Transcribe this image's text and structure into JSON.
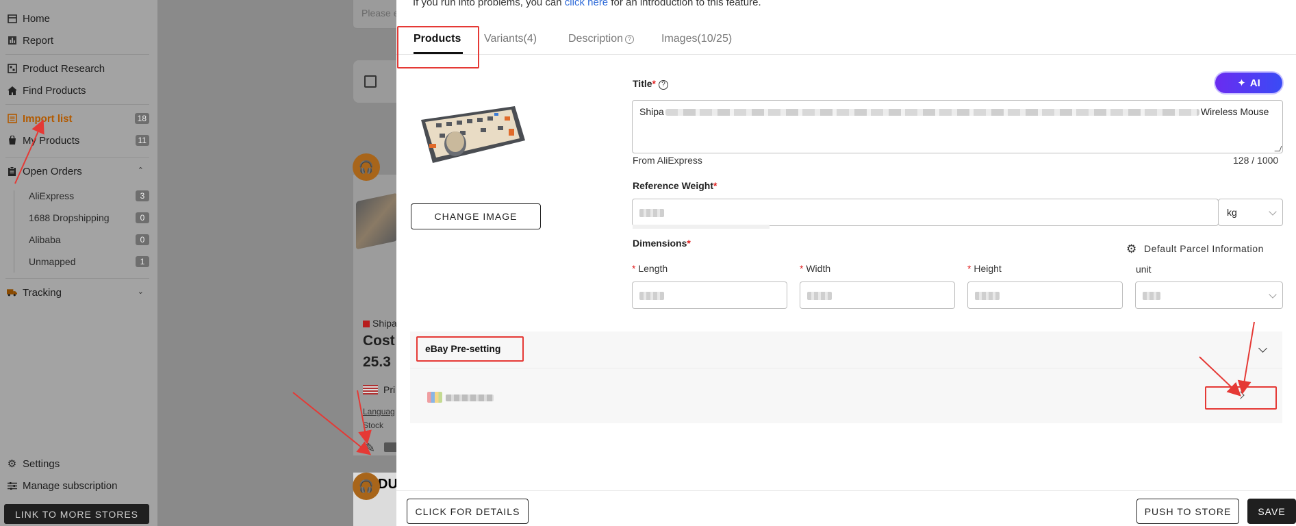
{
  "sidebar": {
    "home": "Home",
    "report": "Report",
    "product_research": "Product Research",
    "find_products": "Find Products",
    "import_list": "Import list",
    "import_list_count": "18",
    "my_products": "My Products",
    "my_products_count": "11",
    "open_orders": "Open Orders",
    "orders": [
      {
        "label": "AliExpress",
        "count": "3"
      },
      {
        "label": "1688 Dropshipping",
        "count": "0"
      },
      {
        "label": "Alibaba",
        "count": "0"
      },
      {
        "label": "Unmapped",
        "count": "1"
      }
    ],
    "tracking": "Tracking",
    "settings": "Settings",
    "manage_subscription": "Manage subscription",
    "link_stores": "LINK TO MORE STORES"
  },
  "background": {
    "search_placeholder": "Please e",
    "shop_name": "Shipa",
    "cost_label": "Cost",
    "price_fragment": "25.3",
    "price_label": "Pri",
    "language_label": "Languag",
    "stock_label": "Stock",
    "card_text": "DU"
  },
  "drawer": {
    "intro_prefix": "If you run into problems, you can ",
    "intro_link": "click here",
    "intro_suffix": " for an introduction to this feature.",
    "tabs": {
      "products": "Products",
      "variants": "Variants(4)",
      "description": "Description",
      "images": "Images(10/25)"
    },
    "change_image": "CHANGE IMAGE",
    "title_label": "Title",
    "ai_button": "AI",
    "title_prefix": "Shipa",
    "title_suffix": "Wireless Mouse",
    "from_source": "From AliExpress",
    "char_count": "128 / 1000",
    "weight_label": "Reference Weight",
    "weight_unit": "kg",
    "dimensions_label": "Dimensions",
    "default_parcel": "Default Parcel Information",
    "length_label": "Length",
    "width_label": "Width",
    "height_label": "Height",
    "unit_label": "unit",
    "ebay_presetting": "eBay Pre-setting",
    "click_for_details": "CLICK FOR DETAILS",
    "push_to_store": "PUSH TO STORE",
    "save": "SAVE"
  },
  "colors": {
    "accent_annotation": "#e53935",
    "ai_gradient_start": "#6a2cf0",
    "ai_gradient_end": "#3a4bf5",
    "link": "#2f6bd8",
    "active_nav": "#b25a00"
  }
}
